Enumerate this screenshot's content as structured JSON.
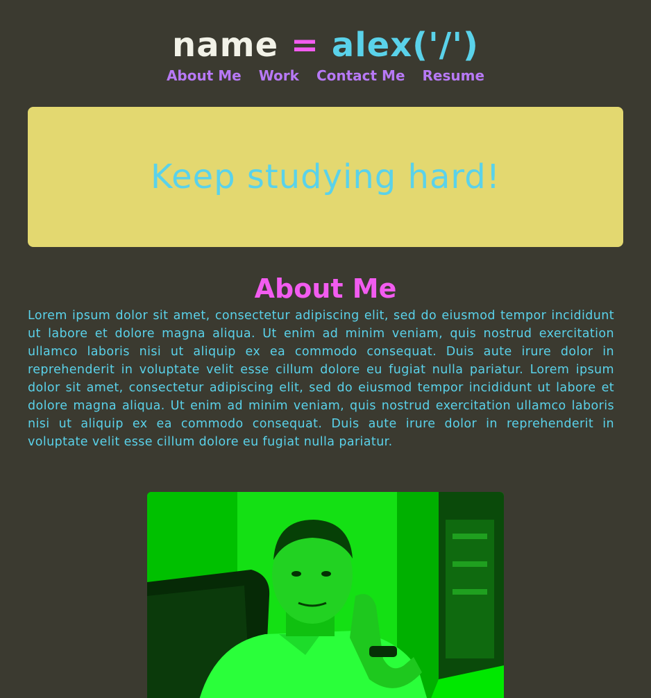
{
  "header": {
    "logo_keyword": "name",
    "logo_equals": "=",
    "logo_value": "alex('/')",
    "nav": [
      {
        "label": "About Me"
      },
      {
        "label": "Work"
      },
      {
        "label": "Contact Me"
      },
      {
        "label": "Resume"
      }
    ]
  },
  "hero": {
    "message": "Keep studying hard!"
  },
  "about": {
    "title": "About Me",
    "body": "Lorem ipsum dolor sit amet, consectetur adipiscing elit, sed do eiusmod tempor incididunt ut labore et dolore magna aliqua. Ut enim ad minim veniam, quis nostrud exercitation ullamco laboris nisi ut aliquip ex ea commodo consequat. Duis aute irure dolor in reprehenderit in voluptate velit esse cillum dolore eu fugiat nulla pariatur. Lorem ipsum dolor sit amet, consectetur adipiscing elit, sed do eiusmod tempor incididunt ut labore et dolore magna aliqua. Ut enim ad minim veniam, quis nostrud exercitation ullamco laboris nisi ut aliquip ex ea commodo consequat. Duis aute irure dolor in reprehenderit in voluptate velit esse cillum dolore eu fugiat nulla pariatur."
  },
  "colors": {
    "background": "#3b3a30",
    "accent_pink": "#f25cf0",
    "accent_cyan": "#5ad2ea",
    "accent_purple": "#b779f5",
    "hero_background": "#e3d870",
    "photo_tint": "#00c800"
  }
}
